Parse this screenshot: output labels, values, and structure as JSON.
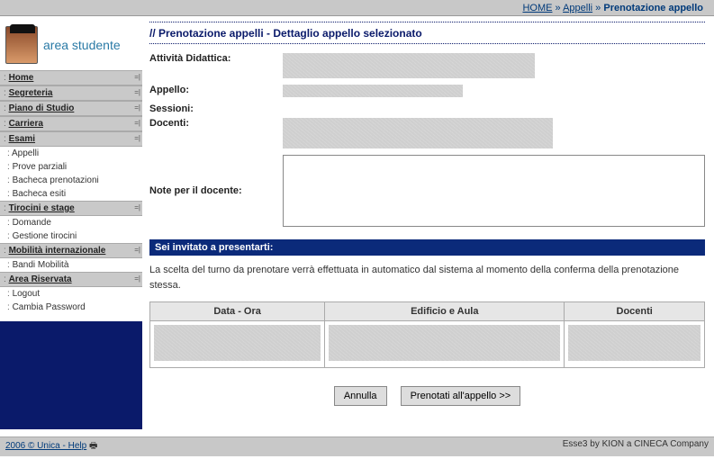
{
  "breadcrumb": {
    "home": "HOME",
    "mid": "Appelli",
    "current": "Prenotazione appello",
    "sep": " » "
  },
  "brand": {
    "text": "area studente"
  },
  "nav": {
    "home": "Home",
    "segreteria": "Segreteria",
    "piano": "Piano di Studio",
    "carriera": "Carriera",
    "esami": "Esami",
    "esami_items": {
      "appelli": "Appelli",
      "parziali": "Prove parziali",
      "bacheca_pren": "Bacheca prenotazioni",
      "bacheca_esiti": "Bacheca esiti"
    },
    "tirocini": "Tirocini e stage",
    "tirocini_items": {
      "domande": "Domande",
      "gestione": "Gestione tirocini"
    },
    "mobilita": "Mobilità internazionale",
    "mobilita_items": {
      "bandi": "Bandi Mobilità"
    },
    "area": "Area Riservata",
    "area_items": {
      "logout": "Logout",
      "cambia": "Cambia Password"
    }
  },
  "header": {
    "title": "// Prenotazione appelli - Dettaglio appello selezionato"
  },
  "fields": {
    "attivita_label": "Attività Didattica:",
    "appello_label": "Appello:",
    "sessioni_label": "Sessioni:",
    "docenti_label": "Docenti:",
    "note_label": "Note per il docente:"
  },
  "invite_bar": "Sei invitato a presentarti:",
  "invite_desc": "La scelta del turno da prenotare verrà effettuata in automatico dal sistema al momento della conferma della prenotazione stessa.",
  "table": {
    "h1": "Data - Ora",
    "h2": "Edificio e Aula",
    "h3": "Docenti"
  },
  "buttons": {
    "cancel": "Annulla",
    "book": "Prenotati all'appello >>"
  },
  "footer": {
    "left": "2006 © Unica - Help",
    "right": "Esse3 by KION a CINECA Company"
  }
}
